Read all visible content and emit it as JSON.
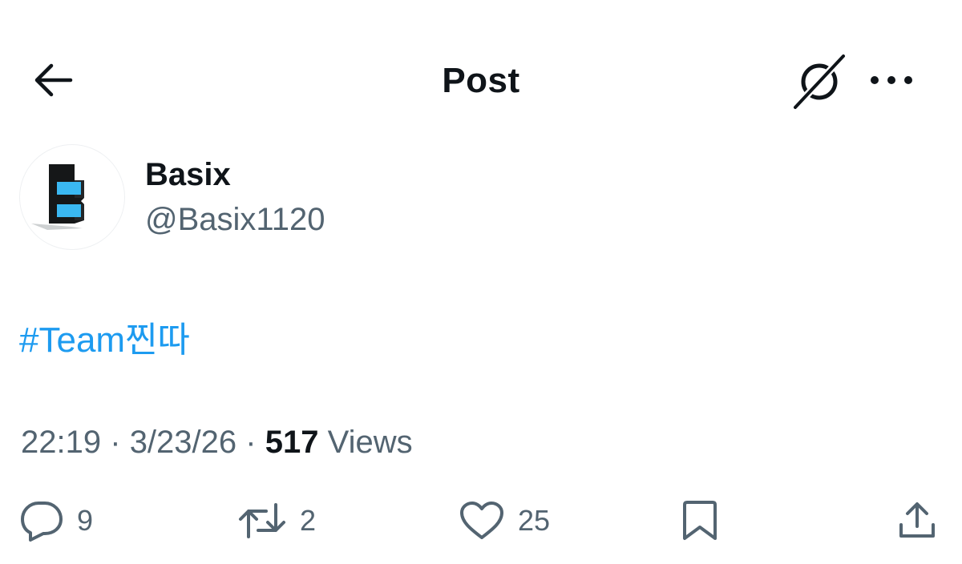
{
  "header": {
    "title": "Post",
    "back_icon": "arrow-left-icon",
    "grok_icon": "grok-icon",
    "more_icon": "more-horizontal-icon"
  },
  "author": {
    "display_name": "Basix",
    "handle": "@Basix1120",
    "avatar_icon": "basix-logo"
  },
  "post": {
    "text": "#Team찐따"
  },
  "meta": {
    "time": "22:19",
    "separator": "·",
    "date": "3/23/26",
    "views_count": "517",
    "views_label": "Views"
  },
  "actions": {
    "replies": "9",
    "reposts": "2",
    "likes": "25"
  },
  "colors": {
    "text_primary": "#0f1419",
    "text_secondary": "#536471",
    "link": "#1d9bf0",
    "logo_blue": "#3ab8f2",
    "logo_dark": "#151718"
  }
}
